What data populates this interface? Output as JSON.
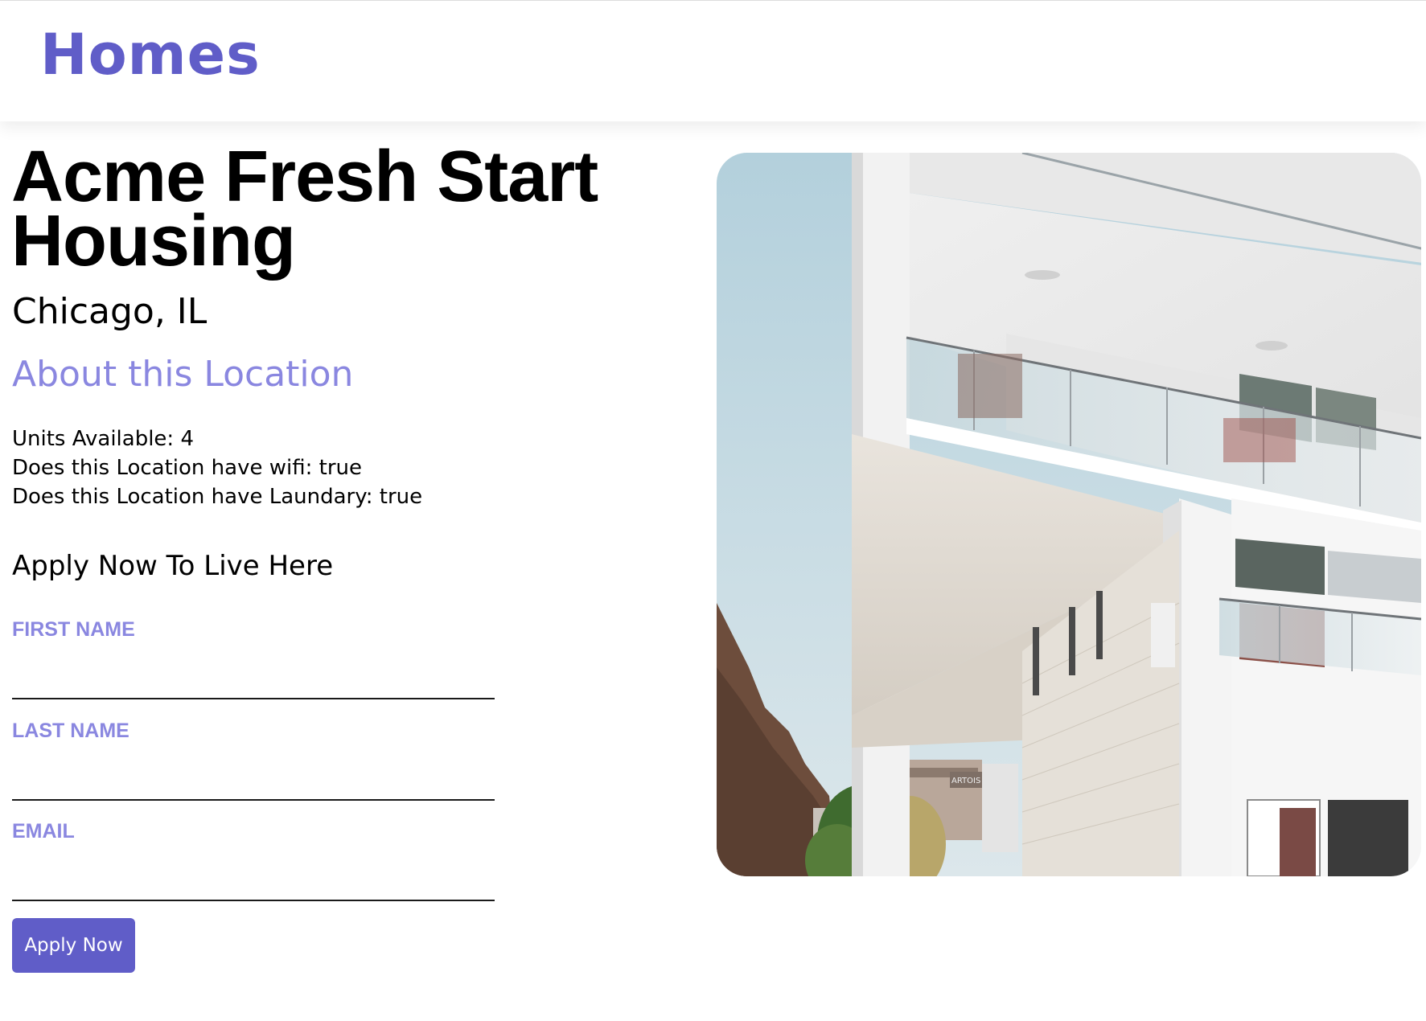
{
  "header": {
    "brand": "Homes"
  },
  "location": {
    "name": "Acme Fresh Start Housing",
    "city_state": "Chicago, IL",
    "about_heading": "About this Location",
    "facts": [
      "Units Available: 4",
      "Does this Location have wifi: true",
      "Does this Location have Laundary: true"
    ]
  },
  "application": {
    "heading": "Apply Now To Live Here",
    "first_name_label": "FIRST NAME",
    "first_name_value": "",
    "last_name_label": "LAST NAME",
    "last_name_value": "",
    "email_label": "EMAIL",
    "email_value": "",
    "submit_label": "Apply Now"
  },
  "photo": {
    "subject": "white modern apartment building with glass balconies",
    "sign_text": "ARTOIS"
  },
  "colors": {
    "brand": "#605DC8",
    "accent_light": "#8A87E0"
  }
}
